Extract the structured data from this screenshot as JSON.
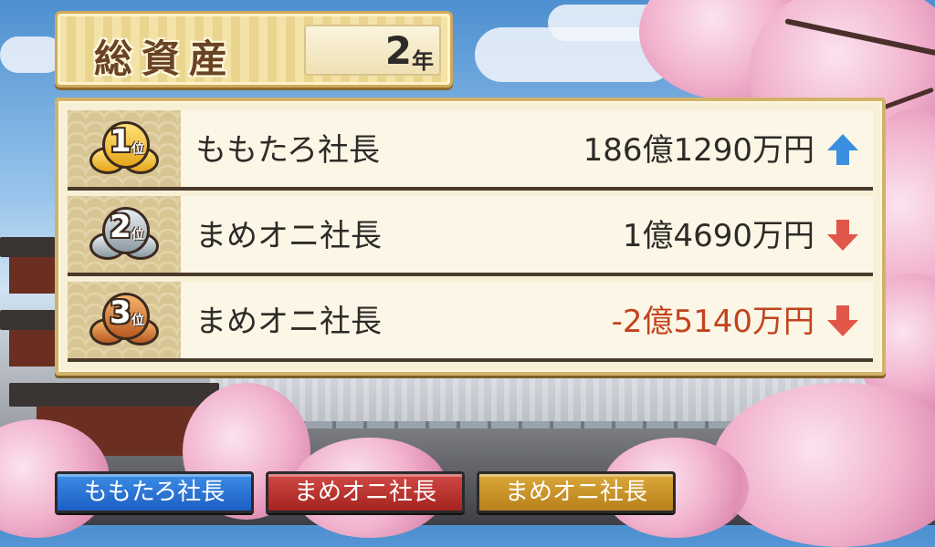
{
  "header": {
    "title": "総資産",
    "year_number": "2",
    "year_unit": "年"
  },
  "ranking": [
    {
      "rank": "1",
      "rank_suffix": "位",
      "medal": "gold",
      "name": "ももたろ社長",
      "amount": "186億1290万円",
      "trend": "up",
      "trend_icon": "arrow-up-icon"
    },
    {
      "rank": "2",
      "rank_suffix": "位",
      "medal": "silver",
      "name": "まめオニ社長",
      "amount": "1億4690万円",
      "trend": "down",
      "trend_icon": "arrow-down-icon"
    },
    {
      "rank": "3",
      "rank_suffix": "位",
      "medal": "bronze",
      "name": "まめオニ社長",
      "amount": "-2億5140万円",
      "trend": "down",
      "trend_icon": "arrow-down-icon"
    }
  ],
  "players": [
    {
      "label": "ももたろ社長",
      "color": "#1c5fc4"
    },
    {
      "label": "まめオニ社長",
      "color": "#a4231f"
    },
    {
      "label": "まめオニ社長",
      "color": "#b8801a"
    }
  ],
  "colors": {
    "trend_up": "#3a8fe0",
    "trend_down": "#e0574a",
    "negative_amount": "#c2431e"
  }
}
